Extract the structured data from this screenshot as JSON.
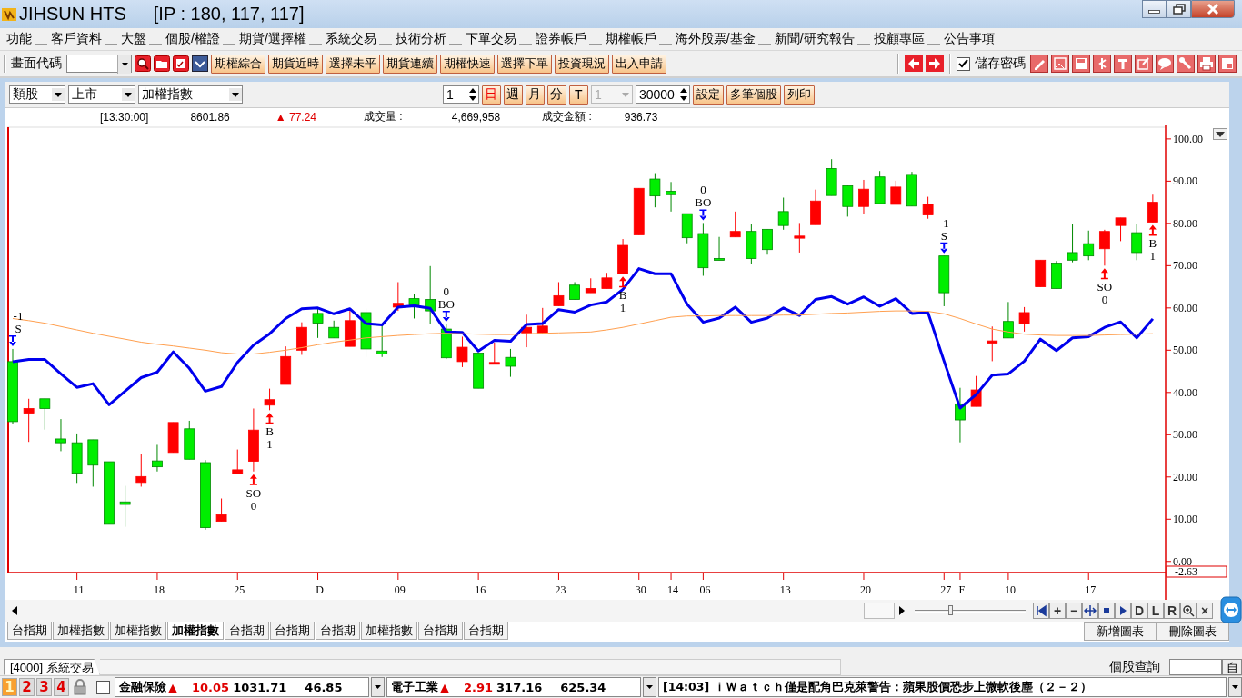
{
  "window": {
    "title": "JIHSUN HTS",
    "ip": "[IP : 180, 117, 117]"
  },
  "menu": [
    "功能",
    "客戶資料",
    "大盤",
    "個股/權證",
    "期貨/選擇權",
    "系統交易",
    "技術分析",
    "下單交易",
    "證券帳戶",
    "期權帳戶",
    "海外股票/基金",
    "新聞/研究報告",
    "投顧專區",
    "公告事項"
  ],
  "toolbar": {
    "code_label": "畫面代碼",
    "buttons": [
      "期權綜合",
      "期貨近時",
      "選擇未平",
      "期貨連續",
      "期權快速",
      "選擇下單",
      "投資現況",
      "出入申請"
    ],
    "save_password": {
      "label": "儲存密碼",
      "checked": true
    }
  },
  "chart_toolbar": {
    "selects": [
      "類股",
      "上市",
      "加權指數"
    ],
    "count": "1",
    "periods": [
      {
        "label": "日",
        "selected": true
      },
      {
        "label": "週",
        "selected": false
      },
      {
        "label": "月",
        "selected": false
      },
      {
        "label": "分",
        "selected": false
      },
      {
        "label": "T",
        "selected": false
      }
    ],
    "minute_select": {
      "value": "1",
      "disabled": true
    },
    "bars": "30000",
    "buttons": [
      "設定",
      "多筆個股",
      "列印"
    ]
  },
  "quote": {
    "time": "[13:30:00]",
    "price": "8601.86",
    "arrow": "▲",
    "rising": true,
    "change": "77.24",
    "volume_label": "成交量 :",
    "volume": "4,669,958",
    "amount_label": "成交金額 :",
    "amount": "936.73"
  },
  "chart_data": {
    "type": "candlestick",
    "ylim": [
      -2.63,
      103.2
    ],
    "categories": [
      null,
      null,
      null,
      null,
      "11",
      null,
      null,
      null,
      null,
      "18",
      null,
      null,
      null,
      null,
      "25",
      null,
      null,
      null,
      null,
      "D",
      null,
      null,
      null,
      null,
      "09",
      null,
      null,
      null,
      null,
      "16",
      null,
      null,
      null,
      null,
      "23",
      null,
      null,
      null,
      null,
      "30",
      null,
      "14",
      null,
      "06",
      null,
      null,
      null,
      null,
      "13",
      null,
      null,
      null,
      null,
      "20",
      null,
      null,
      null,
      null,
      "27",
      "F",
      null,
      null,
      "10",
      null,
      null,
      null,
      null,
      "17",
      null,
      null,
      null,
      null
    ],
    "yticks": [
      {
        "value": 100,
        "label": "100.00"
      },
      {
        "value": 90,
        "label": "90.00"
      },
      {
        "value": 80,
        "label": "80.00"
      },
      {
        "value": 70,
        "label": "70.00"
      },
      {
        "value": 60,
        "label": "60.00"
      },
      {
        "value": 50,
        "label": "50.00"
      },
      {
        "value": 40,
        "label": "40.00"
      },
      {
        "value": 30,
        "label": "30.00"
      },
      {
        "value": 20,
        "label": "20.00"
      },
      {
        "value": 10,
        "label": "10.00"
      },
      {
        "value": 0,
        "label": "0.00"
      }
    ],
    "ohlc": [
      [
        47.3,
        50.3,
        32.6,
        33.1
      ],
      [
        35.1,
        38.5,
        28.3,
        36.2
      ],
      [
        38.5,
        38.5,
        31.2,
        36.2
      ],
      [
        29.0,
        33.7,
        26.1,
        28.1
      ],
      [
        28.1,
        30.3,
        18.6,
        20.9
      ],
      [
        28.8,
        28.8,
        17.7,
        22.8
      ],
      [
        23.6,
        23.6,
        8.8,
        8.8
      ],
      [
        14.1,
        17.9,
        8.2,
        13.5
      ],
      [
        18.7,
        25.4,
        17.7,
        20.1
      ],
      [
        23.8,
        27.6,
        21.3,
        22.4
      ],
      [
        25.8,
        32.9,
        25.8,
        32.9
      ],
      [
        31.4,
        33.3,
        24.2,
        24.2
      ],
      [
        23.4,
        24.0,
        7.5,
        8.0
      ],
      [
        9.5,
        14.9,
        9.5,
        11.1
      ],
      [
        20.8,
        26.5,
        20.8,
        21.7
      ],
      [
        23.7,
        36.2,
        21.3,
        31.1
      ],
      [
        37.0,
        40.9,
        35.8,
        38.3
      ],
      [
        41.9,
        50.9,
        41.9,
        48.5
      ],
      [
        50.0,
        56.6,
        48.9,
        55.4
      ],
      [
        58.7,
        59.8,
        52.9,
        56.4
      ],
      [
        55.4,
        57.0,
        52.9,
        52.9
      ],
      [
        50.9,
        59.3,
        50.9,
        57.0
      ],
      [
        58.9,
        59.9,
        48.4,
        50.3
      ],
      [
        49.8,
        55.9,
        48.4,
        49.1
      ],
      [
        60.2,
        66.1,
        59.3,
        61.1
      ],
      [
        62.2,
        63.4,
        57.5,
        60.7
      ],
      [
        62.0,
        69.9,
        56.1,
        59.3
      ],
      [
        55.0,
        56.1,
        47.9,
        48.2
      ],
      [
        47.3,
        53.2,
        46.0,
        50.7
      ],
      [
        49.3,
        49.3,
        41.0,
        41.0
      ],
      [
        46.7,
        51.8,
        46.7,
        47.1
      ],
      [
        48.3,
        50.3,
        43.7,
        46.2
      ],
      [
        54.1,
        58.4,
        50.7,
        55.4
      ],
      [
        54.1,
        60.0,
        54.1,
        55.7
      ],
      [
        60.5,
        66.1,
        60.5,
        62.9
      ],
      [
        65.4,
        66.1,
        62.0,
        62.0
      ],
      [
        63.6,
        67.0,
        63.6,
        64.6
      ],
      [
        64.6,
        68.3,
        64.6,
        67.1
      ],
      [
        68.1,
        76.3,
        68.1,
        74.8
      ],
      [
        77.3,
        88.3,
        77.3,
        88.3
      ],
      [
        90.5,
        91.9,
        83.8,
        86.5
      ],
      [
        87.6,
        89.8,
        82.8,
        86.8
      ],
      [
        82.3,
        82.3,
        75.3,
        76.6
      ],
      [
        77.6,
        80.1,
        67.6,
        69.5
      ],
      [
        71.7,
        76.8,
        71.3,
        71.3
      ],
      [
        76.8,
        82.8,
        76.8,
        78.1
      ],
      [
        78.1,
        79.8,
        70.3,
        71.7
      ],
      [
        78.6,
        78.6,
        72.6,
        73.8
      ],
      [
        82.8,
        86.1,
        78.5,
        79.5
      ],
      [
        76.5,
        80.1,
        73.1,
        77.0
      ],
      [
        79.7,
        88.0,
        79.7,
        85.3
      ],
      [
        93.0,
        95.2,
        86.6,
        86.6
      ],
      [
        88.9,
        88.9,
        81.6,
        84.0
      ],
      [
        84.0,
        90.3,
        82.3,
        88.1
      ],
      [
        91.0,
        92.4,
        84.7,
        84.7
      ],
      [
        84.5,
        90.1,
        84.5,
        88.6
      ],
      [
        91.6,
        92.2,
        84.1,
        84.1
      ],
      [
        82.0,
        86.3,
        81.1,
        84.6
      ],
      [
        72.3,
        72.3,
        60.4,
        63.6
      ],
      [
        37.3,
        41.1,
        28.2,
        33.5
      ],
      [
        36.7,
        43.9,
        36.7,
        40.6
      ],
      [
        51.7,
        55.6,
        47.4,
        52.2
      ],
      [
        56.8,
        61.4,
        52.9,
        52.9
      ],
      [
        56.2,
        60.2,
        54.4,
        58.9
      ],
      [
        65.0,
        71.3,
        65.0,
        71.3
      ],
      [
        70.6,
        71.1,
        64.6,
        64.6
      ],
      [
        73.1,
        79.8,
        70.8,
        71.3
      ],
      [
        75.2,
        78.3,
        71.3,
        72.3
      ],
      [
        74.0,
        78.5,
        70.0,
        78.1
      ],
      [
        79.5,
        81.3,
        75.8,
        81.3
      ],
      [
        77.8,
        79.8,
        71.3,
        73.1
      ],
      [
        80.3,
        86.8,
        80.3,
        85.0
      ]
    ],
    "series": [
      {
        "type": "line",
        "color": "#0000ee",
        "values": [
          47.3,
          47.8,
          47.8,
          44.4,
          41.2,
          42.1,
          37.1,
          40.3,
          43.5,
          44.8,
          49.6,
          45.7,
          40.3,
          41.4,
          47.1,
          51.2,
          53.9,
          57.5,
          59.8,
          60.0,
          58.6,
          59.8,
          56.3,
          56.0,
          60.2,
          60.5,
          59.9,
          54.3,
          54.2,
          49.8,
          52.3,
          52.1,
          56.1,
          56.3,
          59.6,
          59.0,
          60.7,
          61.4,
          64.4,
          69.3,
          68.1,
          68.1,
          60.9,
          56.6,
          57.6,
          60.2,
          56.6,
          57.6,
          60.0,
          58.2,
          62.0,
          62.7,
          60.9,
          62.6,
          60.4,
          62.2,
          58.7,
          58.9,
          47.4,
          36.3,
          39.5,
          44.1,
          44.4,
          47.4,
          52.6,
          49.9,
          52.9,
          53.2,
          55.4,
          56.7,
          52.9,
          57.4
        ]
      },
      {
        "type": "line",
        "color": "#ffa050",
        "values": [
          57.5,
          57.0,
          56.4,
          55.6,
          54.8,
          54.0,
          53.3,
          52.6,
          51.9,
          51.4,
          51.0,
          50.5,
          50.0,
          49.4,
          49.1,
          49.1,
          49.5,
          50.0,
          50.6,
          51.3,
          51.9,
          52.4,
          52.9,
          53.2,
          53.5,
          53.7,
          53.9,
          54.0,
          53.9,
          53.8,
          53.7,
          53.7,
          53.9,
          54.0,
          54.1,
          54.2,
          54.3,
          54.8,
          55.4,
          56.2,
          57.0,
          57.8,
          58.1,
          58.1,
          58.2,
          58.2,
          58.2,
          58.2,
          58.3,
          58.3,
          58.5,
          58.7,
          58.8,
          59.0,
          59.2,
          59.3,
          59.3,
          59.2,
          58.6,
          57.5,
          56.2,
          55.0,
          54.3,
          53.8,
          53.6,
          53.5,
          53.5,
          53.5,
          53.6,
          53.7,
          53.8,
          53.9
        ]
      }
    ],
    "annotations": [
      "-1 S",
      "SO 0",
      "B 1",
      "0 BO",
      "B 1",
      "0 BO",
      "-1 S",
      "SO 0",
      "B 1"
    ]
  },
  "chart_marker": {
    "label": "-2.63"
  },
  "zoom_slider": {
    "level": 0.3
  },
  "nav_tools": [
    {
      "kind": "first"
    },
    {
      "kind": "text",
      "label": "+"
    },
    {
      "kind": "text",
      "label": "−"
    },
    {
      "kind": "move"
    },
    {
      "kind": "stop"
    },
    {
      "kind": "play"
    },
    {
      "kind": "text",
      "label": "D"
    },
    {
      "kind": "text",
      "label": "L"
    },
    {
      "kind": "text",
      "label": "R"
    },
    {
      "kind": "zoom"
    },
    {
      "kind": "text",
      "label": "×"
    }
  ],
  "chart_tabs": [
    {
      "label": "台指期",
      "selected": false
    },
    {
      "label": "加權指數",
      "selected": false
    },
    {
      "label": "加權指數",
      "selected": false
    },
    {
      "label": "加權指數",
      "selected": true
    },
    {
      "label": "台指期",
      "selected": false
    },
    {
      "label": "台指期",
      "selected": false
    },
    {
      "label": "台指期",
      "selected": false
    },
    {
      "label": "加權指數",
      "selected": false
    },
    {
      "label": "台指期",
      "selected": false
    },
    {
      "label": "台指期",
      "selected": false
    }
  ],
  "chart_actions": [
    "新增圖表",
    "刪除圖表"
  ],
  "task_tab": "[4000] 系統交易",
  "stock_query": {
    "label": "個股查詢",
    "button": "自"
  },
  "ticker": {
    "pages": [
      {
        "label": "1",
        "selected": true
      },
      {
        "label": "2",
        "selected": false
      },
      {
        "label": "3",
        "selected": false
      },
      {
        "label": "4",
        "selected": false
      }
    ],
    "checkbox": {
      "checked": false
    },
    "sectors": [
      {
        "name": "金融保險",
        "arrow": "▲",
        "rising": true,
        "change": "10.05",
        "index": "1031.71",
        "volume": "46.85"
      },
      {
        "name": "電子工業",
        "arrow": "▲",
        "rising": true,
        "change": "2.91",
        "index": "317.16",
        "volume": "625.34"
      }
    ],
    "news": "[14:03] ｉＷａｔｃｈ僅是配角巴克萊警告：蘋果股價恐步上微軟後塵（２－２）"
  }
}
